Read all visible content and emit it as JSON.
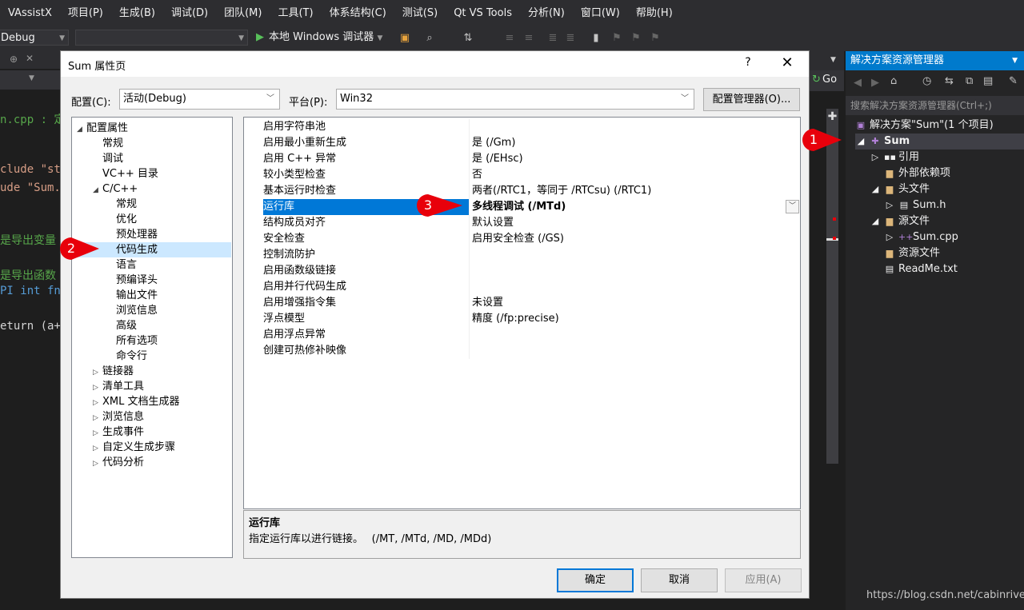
{
  "menu": [
    "VAssistX",
    "项目(P)",
    "生成(B)",
    "调试(D)",
    "团队(M)",
    "工具(T)",
    "体系结构(C)",
    "测试(S)",
    "Qt VS Tools",
    "分析(N)",
    "窗口(W)",
    "帮助(H)"
  ],
  "toolbar": {
    "config": "Debug",
    "run_label": "本地 Windows 调试器",
    "go_label": "Go"
  },
  "editor": {
    "lines": [
      {
        "text": "n.cpp : 定",
        "color": "#57a64a"
      },
      {
        "text": "clude \"st",
        "color": "#d69d85"
      },
      {
        "text": "ude \"Sum.",
        "color": "#d69d85"
      },
      {
        "text": "是导出变量",
        "color": "#57a64a"
      },
      {
        "text": "是导出函数",
        "color": "#57a64a"
      },
      {
        "text": "PI int fn",
        "color": "#569cd6"
      },
      {
        "text": "eturn (a+b",
        "color": "#d4d4d4"
      }
    ]
  },
  "solution": {
    "title": "解决方案资源管理器",
    "search_placeholder": "搜索解决方案资源管理器(Ctrl+;)",
    "nodes": [
      {
        "label": "解决方案\"Sum\"(1 个项目)",
        "icon": "solution-icon"
      },
      {
        "label": "Sum",
        "icon": "project-icon"
      },
      {
        "label": "引用",
        "icon": "references-icon"
      },
      {
        "label": "外部依赖项",
        "icon": "folder-icon"
      },
      {
        "label": "头文件",
        "icon": "folder-icon"
      },
      {
        "label": "Sum.h",
        "icon": "header-file-icon"
      },
      {
        "label": "源文件",
        "icon": "folder-icon"
      },
      {
        "label": "Sum.cpp",
        "icon": "cpp-file-icon"
      },
      {
        "label": "资源文件",
        "icon": "folder-icon"
      },
      {
        "label": "ReadMe.txt",
        "icon": "text-file-icon"
      }
    ]
  },
  "dialog": {
    "title": "Sum 属性页",
    "help": "?",
    "config_label": "配置(C):",
    "config_value": "活动(Debug)",
    "platform_label": "平台(P):",
    "platform_value": "Win32",
    "config_manager": "配置管理器(O)...",
    "tree": [
      "配置属性",
      "常规",
      "调试",
      "VC++ 目录",
      "C/C++",
      "常规",
      "优化",
      "预处理器",
      "代码生成",
      "语言",
      "预编译头",
      "输出文件",
      "浏览信息",
      "高级",
      "所有选项",
      "命令行",
      "链接器",
      "清单工具",
      "XML 文档生成器",
      "浏览信息",
      "生成事件",
      "自定义生成步骤",
      "代码分析"
    ],
    "props": [
      {
        "name": "启用字符串池",
        "value": ""
      },
      {
        "name": "启用最小重新生成",
        "value": "是 (/Gm)"
      },
      {
        "name": "启用 C++ 异常",
        "value": "是 (/EHsc)"
      },
      {
        "name": "较小类型检查",
        "value": "否"
      },
      {
        "name": "基本运行时检查",
        "value": "两者(/RTC1，等同于 /RTCsu) (/RTC1)"
      },
      {
        "name": "运行库",
        "value": "多线程调试 (/MTd)"
      },
      {
        "name": "结构成员对齐",
        "value": "默认设置"
      },
      {
        "name": "安全检查",
        "value": "启用安全检查 (/GS)"
      },
      {
        "name": "控制流防护",
        "value": ""
      },
      {
        "name": "启用函数级链接",
        "value": ""
      },
      {
        "name": "启用并行代码生成",
        "value": ""
      },
      {
        "name": "启用增强指令集",
        "value": "未设置"
      },
      {
        "name": "浮点模型",
        "value": "精度 (/fp:precise)"
      },
      {
        "name": "启用浮点异常",
        "value": ""
      },
      {
        "name": "创建可热修补映像",
        "value": ""
      }
    ],
    "desc_title": "运行库",
    "desc_text": "指定运行库以进行链接。　 (/MT, /MTd, /MD, /MDd)",
    "ok": "确定",
    "cancel": "取消",
    "apply": "应用(A)"
  },
  "markers": [
    "1",
    "2",
    "3"
  ],
  "watermark": "https://blog.csdn.net/cabinriver",
  "colors": {
    "accent": "#007acc",
    "selection": "#0078d7",
    "marker": "#e8000b"
  }
}
